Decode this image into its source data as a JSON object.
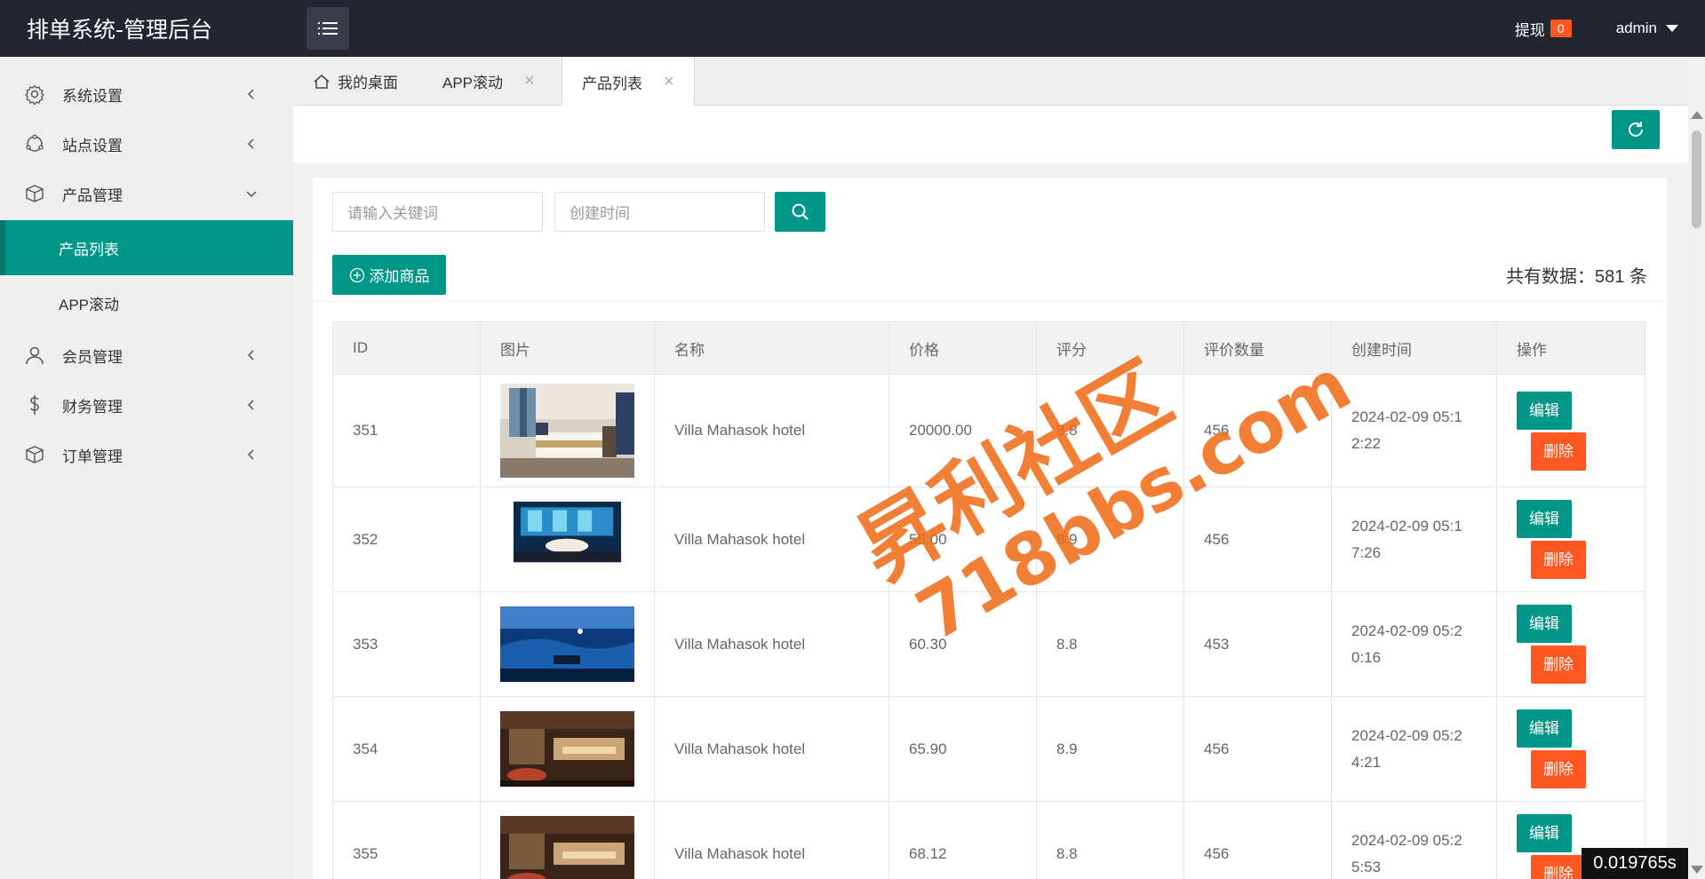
{
  "header": {
    "app_title": "排单系统-管理后台",
    "withdraw_label": "提现",
    "withdraw_count": "0",
    "user_name": "admin"
  },
  "sidebar": {
    "items": [
      {
        "label": "系统设置",
        "icon": "gear-icon"
      },
      {
        "label": "站点设置",
        "icon": "cloud-icon"
      },
      {
        "label": "产品管理",
        "icon": "box-icon"
      },
      {
        "label": "会员管理",
        "icon": "user-icon"
      },
      {
        "label": "财务管理",
        "icon": "dollar-icon"
      },
      {
        "label": "订单管理",
        "icon": "box-icon"
      }
    ],
    "sub_items": [
      {
        "label": "产品列表",
        "active": true
      },
      {
        "label": "APP滚动",
        "active": false
      }
    ]
  },
  "tabs": [
    {
      "label": "我的桌面",
      "icon": "home-icon"
    },
    {
      "label": "APP滚动"
    },
    {
      "label": "产品列表",
      "active": true
    }
  ],
  "search": {
    "keyword_placeholder": "请输入关键词",
    "date_placeholder": "创建时间"
  },
  "toolbar": {
    "add_label": "添加商品",
    "total_label": "共有数据：581 条"
  },
  "table": {
    "headers": [
      "ID",
      "图片",
      "名称",
      "价格",
      "评分",
      "评价数量",
      "创建时间",
      "操作"
    ],
    "edit_label": "编辑",
    "delete_label": "删除",
    "rows": [
      {
        "id": "351",
        "name": "Villa Mahasok hotel",
        "price": "20000.00",
        "rating": "8.8",
        "reviews": "456",
        "created": "2024-02-09 05:12:22",
        "created_l1": "2024-02-09 05:1",
        "created_l2": "2:22",
        "image": "hotel-bedroom"
      },
      {
        "id": "352",
        "name": "Villa Mahasok hotel",
        "price": "55.00",
        "rating": "8.9",
        "reviews": "456",
        "created": "2024-02-09 05:17:26",
        "created_l1": "2024-02-09 05:1",
        "created_l2": "7:26",
        "image": "restaurant-night"
      },
      {
        "id": "353",
        "name": "Villa Mahasok hotel",
        "price": "60.30",
        "rating": "8.8",
        "reviews": "453",
        "created": "2024-02-09 05:20:16",
        "created_l1": "2024-02-09 05:2",
        "created_l2": "0:16",
        "image": "underwater-dining"
      },
      {
        "id": "354",
        "name": "Villa Mahasok hotel",
        "price": "65.90",
        "rating": "8.9",
        "reviews": "456",
        "created": "2024-02-09 05:24:21",
        "created_l1": "2024-02-09 05:2",
        "created_l2": "4:21",
        "image": "buffet"
      },
      {
        "id": "355",
        "name": "Villa Mahasok hotel",
        "price": "68.12",
        "rating": "8.8",
        "reviews": "456",
        "created": "2024-02-09 05:25:53",
        "created_l1": "2024-02-09 05:2",
        "created_l2": "5:53",
        "image": "buffet"
      }
    ]
  },
  "timer": "0.019765s",
  "watermark": {
    "line1": "昇利社区",
    "line2": "718bbs.com"
  },
  "colors": {
    "primary": "#009688",
    "danger": "#ff5722",
    "header_bg": "#23262e"
  }
}
